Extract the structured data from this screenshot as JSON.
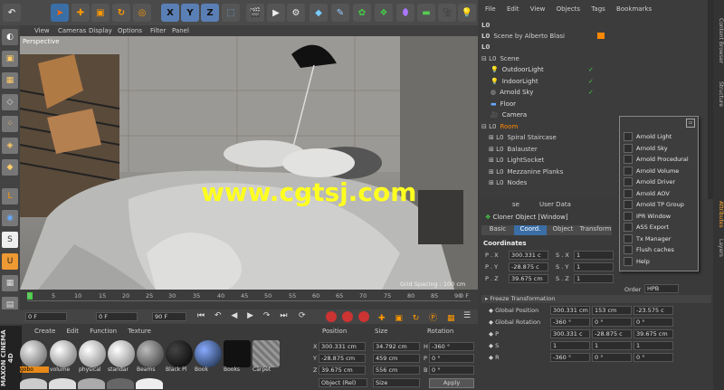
{
  "toolbar": {
    "axis_x": "X",
    "axis_y": "Y",
    "axis_z": "Z"
  },
  "viewport": {
    "menu": [
      "View",
      "Cameras",
      "Display",
      "Options",
      "Filter",
      "Panel"
    ],
    "label": "Perspective",
    "grid_spacing": "Grid Spacing : 100 cm"
  },
  "watermark": "www.cgtsj.com",
  "objmgr": {
    "menu": [
      "File",
      "Edit",
      "View",
      "Objects",
      "Tags",
      "Bookmarks"
    ],
    "items": [
      "Scene by Alberto Blasi",
      "Scene",
      "OutdoorLight",
      "IndoorLight",
      "Arnold Sky",
      "Floor",
      "Camera",
      "Room",
      "Spiral Staircase",
      "Balauster",
      "LightSocket",
      "Mezzanine Planks",
      "Nodes"
    ]
  },
  "context_menu": {
    "items": [
      "Arnold Light",
      "Arnold Sky",
      "Arnold Procedural",
      "Arnold Volume",
      "Arnold Driver",
      "Arnold AOV",
      "Arnold TP Group",
      "IPR Window",
      "ASS Export",
      "Tx Manager",
      "Flush caches",
      "Help"
    ]
  },
  "attr": {
    "tabs_top": [
      "se",
      "User Data"
    ],
    "object_title": "Cloner Object [Window]",
    "tabs": [
      "Basic",
      "Coord.",
      "Object",
      "Transform"
    ],
    "section": "Coordinates",
    "rows": [
      {
        "a": "P . X",
        "v1": "300.331 c",
        "b": "S . X",
        "v2": "1"
      },
      {
        "a": "P . Y",
        "v1": "-28.875 c",
        "b": "S . Y",
        "v2": "1"
      },
      {
        "a": "P . Z",
        "v1": "39.675 cm",
        "b": "S . Z",
        "v2": "1"
      }
    ],
    "order_label": "Order",
    "order_value": "HPB",
    "freeze": "Freeze Transformation",
    "global": [
      {
        "l": "Global Position",
        "v": [
          "300.331 cm",
          "153 cm",
          "-23.575 c"
        ]
      },
      {
        "l": "Global Rotation",
        "v": [
          "-360 °",
          "0 °",
          "0 °"
        ]
      },
      {
        "l": "P",
        "v": [
          "300.331 c",
          "-28.875 c",
          "39.675 cm"
        ]
      },
      {
        "l": "S",
        "v": [
          "1",
          "1",
          "1"
        ]
      },
      {
        "l": "R",
        "v": [
          "-360 °",
          "0 °",
          "0 °"
        ]
      }
    ]
  },
  "timeline": {
    "ticks": [
      "0",
      "5",
      "10",
      "15",
      "20",
      "25",
      "30",
      "35",
      "40",
      "45",
      "50",
      "55",
      "60",
      "65",
      "70",
      "75",
      "80",
      "85",
      "90"
    ],
    "start": "0 F",
    "current": "0 F",
    "end": "90 F",
    "end2": "90 F",
    "frame_display": "0 F"
  },
  "materials": {
    "menu": [
      "Create",
      "Edit",
      "Function",
      "Texture"
    ],
    "items": [
      "gobo",
      "volume",
      "physical",
      "standar",
      "Beams",
      "Black Pl",
      "Book",
      "Books",
      "Carpet"
    ]
  },
  "coords": {
    "headers": [
      "Position",
      "Size",
      "Rotation"
    ],
    "rows": [
      {
        "ax": "X",
        "p": "300.331 cm",
        "s": "34.792 cm",
        "rl": "H",
        "r": "-360 °"
      },
      {
        "ax": "Y",
        "p": "-28.875 cm",
        "s": "459 cm",
        "rl": "P",
        "r": "0 °"
      },
      {
        "ax": "Z",
        "p": "39.675 cm",
        "s": "556 cm",
        "rl": "B",
        "r": "0 °"
      }
    ],
    "mode": "Object (Rel)",
    "size_mode": "Size",
    "apply": "Apply"
  },
  "side_tabs": [
    "Content Browser",
    "Structure",
    "Attributes",
    "Layers"
  ],
  "brand": "MAXON CINEMA 4D"
}
